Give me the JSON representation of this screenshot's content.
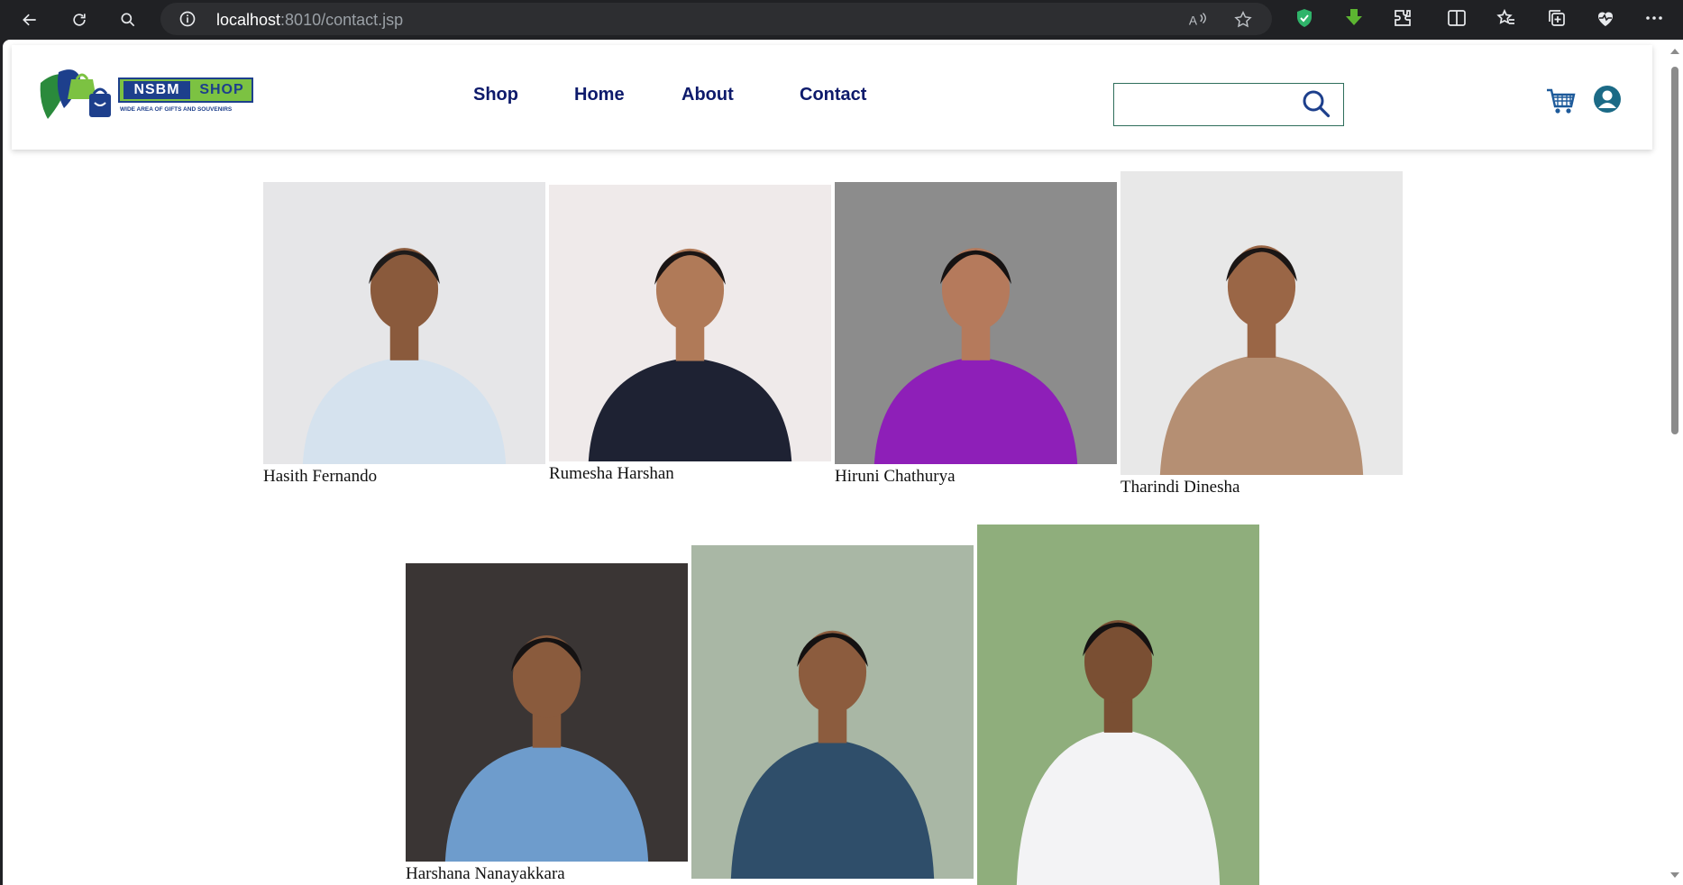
{
  "browser": {
    "url_host": "localhost",
    "url_rest": ":8010/contact.jsp"
  },
  "site": {
    "logo_primary": "NSBM",
    "logo_secondary": "SHOP",
    "logo_tagline": "WIDE AREA OF GIFTS AND SOUVENIRS",
    "nav": [
      "Shop",
      "Home",
      "About",
      "Contact"
    ],
    "search_value": "",
    "colors": {
      "nav": "#0d1a6b",
      "brand_blue": "#1d3f8c",
      "brand_green": "#7cc242"
    }
  },
  "team": [
    {
      "name": "Hasith Fernando",
      "bg": "#e6e6e8",
      "shirt": "#d5e2ee",
      "skin": "#8a5a3c",
      "hair": "#1e1b1a"
    },
    {
      "name": "Rumesha Harshan",
      "bg": "#efeaea",
      "shirt": "#1e2233",
      "skin": "#b07a58",
      "hair": "#1b1514"
    },
    {
      "name": "Hiruni Chathurya",
      "bg": "#8c8c8c",
      "shirt": "#8e1fb8",
      "skin": "#b57a5c",
      "hair": "#161212"
    },
    {
      "name": "Tharindi Dinesha",
      "bg": "#e8e8e8",
      "shirt": "#b58f73",
      "skin": "#9a6646",
      "hair": "#1b1615"
    },
    {
      "name": "Harshana Nanayakkara",
      "bg": "#3a3534",
      "shirt": "#6e9ccc",
      "skin": "#8a5b3d",
      "hair": "#151212"
    },
    {
      "name": "",
      "bg": "#a9b7a5",
      "shirt": "#2f4e6a",
      "skin": "#8c5c3e",
      "hair": "#141111"
    },
    {
      "name": "",
      "bg": "#8fae7c",
      "shirt": "#f3f3f5",
      "skin": "#7a4f33",
      "hair": "#151212"
    }
  ]
}
